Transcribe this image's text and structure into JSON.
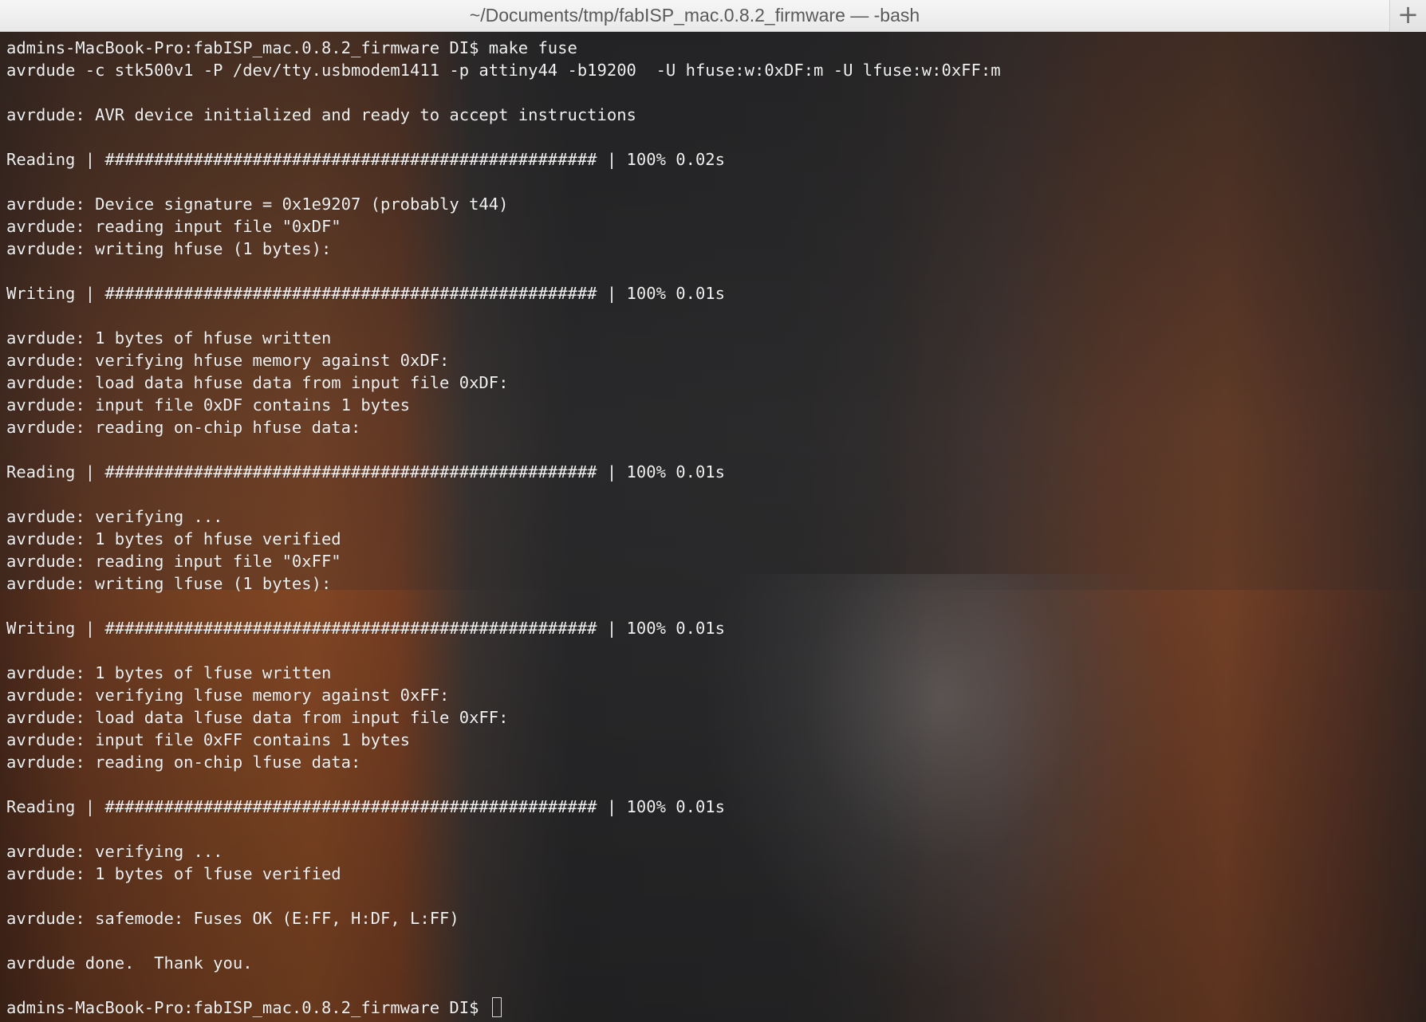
{
  "window": {
    "title": "~/Documents/tmp/fabISP_mac.0.8.2_firmware — -bash",
    "new_tab_glyph": "+"
  },
  "terminal": {
    "lines": [
      "admins-MacBook-Pro:fabISP_mac.0.8.2_firmware DI$ make fuse",
      "avrdude -c stk500v1 -P /dev/tty.usbmodem1411 -p attiny44 -b19200  -U hfuse:w:0xDF:m -U lfuse:w:0xFF:m",
      "",
      "avrdude: AVR device initialized and ready to accept instructions",
      "",
      "Reading | ################################################## | 100% 0.02s",
      "",
      "avrdude: Device signature = 0x1e9207 (probably t44)",
      "avrdude: reading input file \"0xDF\"",
      "avrdude: writing hfuse (1 bytes):",
      "",
      "Writing | ################################################## | 100% 0.01s",
      "",
      "avrdude: 1 bytes of hfuse written",
      "avrdude: verifying hfuse memory against 0xDF:",
      "avrdude: load data hfuse data from input file 0xDF:",
      "avrdude: input file 0xDF contains 1 bytes",
      "avrdude: reading on-chip hfuse data:",
      "",
      "Reading | ################################################## | 100% 0.01s",
      "",
      "avrdude: verifying ...",
      "avrdude: 1 bytes of hfuse verified",
      "avrdude: reading input file \"0xFF\"",
      "avrdude: writing lfuse (1 bytes):",
      "",
      "Writing | ################################################## | 100% 0.01s",
      "",
      "avrdude: 1 bytes of lfuse written",
      "avrdude: verifying lfuse memory against 0xFF:",
      "avrdude: load data lfuse data from input file 0xFF:",
      "avrdude: input file 0xFF contains 1 bytes",
      "avrdude: reading on-chip lfuse data:",
      "",
      "Reading | ################################################## | 100% 0.01s",
      "",
      "avrdude: verifying ...",
      "avrdude: 1 bytes of lfuse verified",
      "",
      "avrdude: safemode: Fuses OK (E:FF, H:DF, L:FF)",
      "",
      "avrdude done.  Thank you.",
      ""
    ],
    "prompt": "admins-MacBook-Pro:fabISP_mac.0.8.2_firmware DI$ "
  }
}
